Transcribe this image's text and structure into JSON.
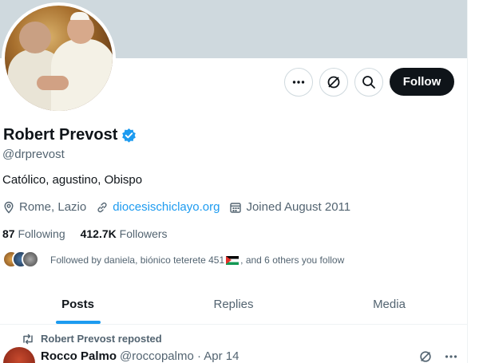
{
  "profile": {
    "name": "Robert Prevost",
    "handle": "@drprevost",
    "bio": "Católico, agustino, Obispo",
    "location": "Rome, Lazio",
    "website": "diocesischiclayo.org",
    "joined": "Joined August 2011",
    "following_count": "87",
    "following_label": "Following",
    "followers_count": "412.7K",
    "followers_label": "Followers",
    "followed_by": "Followed by daniela, biónico teterete 451",
    "followed_by_suffix": ", and 6 others you follow"
  },
  "actions": {
    "follow_label": "Follow",
    "more_icon": "more-icon",
    "grok_icon": "grok-icon",
    "search_icon": "search-icon"
  },
  "tabs": [
    {
      "label": "Posts",
      "active": true
    },
    {
      "label": "Replies",
      "active": false
    },
    {
      "label": "Media",
      "active": false
    }
  ],
  "post": {
    "repost_label": "Robert Prevost reposted",
    "author_name": "Rocco Palmo",
    "author_handle_date": "@roccopalmo · Apr 14"
  },
  "colors": {
    "accent": "#1d9bf0",
    "banner": "#cfd9de",
    "verified": "#1d9bf0",
    "text_secondary": "#536471"
  }
}
